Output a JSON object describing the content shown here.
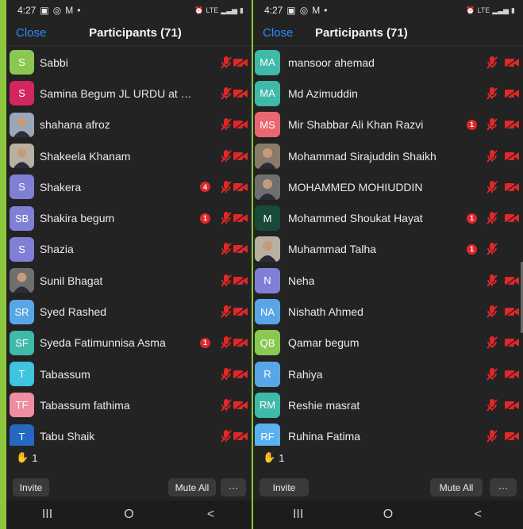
{
  "status": {
    "time": "4:27",
    "right": "LTE"
  },
  "header": {
    "close": "Close",
    "title": "Participants (71)"
  },
  "hand_count": "1",
  "buttons": {
    "invite": "Invite",
    "mute_all": "Mute All",
    "more": "···"
  },
  "nav": {
    "recents": "III",
    "home": "O",
    "back": "<"
  },
  "colors": {
    "pink": "#d3255f",
    "green": "#8ac851",
    "lavender": "#7f7fd6",
    "blue": "#58a6e6",
    "teal": "#3fb9a8",
    "cyan": "#3fc3de",
    "salmon": "#f08da1",
    "red": "#e86770",
    "dark": "#1a4a39",
    "tb": "#2468c1",
    "ruhina": "#5bb0f0"
  },
  "left_participants": [
    {
      "initials": "S",
      "name": "Sabbi",
      "color": "green",
      "photo": false
    },
    {
      "initials": "S",
      "name": "Samina Begum JL URDU at Jad...",
      "color": "pink",
      "photo": false
    },
    {
      "initials": "",
      "name": "shahana afroz",
      "color": "",
      "photo": true
    },
    {
      "initials": "",
      "name": "Shakeela Khanam",
      "color": "",
      "photo": true
    },
    {
      "initials": "S",
      "name": "Shakera",
      "color": "lavender",
      "photo": false,
      "badge": "4"
    },
    {
      "initials": "SB",
      "name": "Shakira begum",
      "color": "lavender",
      "photo": false,
      "badge": "1"
    },
    {
      "initials": "S",
      "name": "Shazia",
      "color": "lavender",
      "photo": false
    },
    {
      "initials": "",
      "name": "Sunil Bhagat",
      "color": "",
      "photo": true
    },
    {
      "initials": "SR",
      "name": "Syed Rashed",
      "color": "blue",
      "photo": false
    },
    {
      "initials": "SF",
      "name": "Syeda Fatimunnisa Asma",
      "color": "teal",
      "photo": false,
      "badge": "1"
    },
    {
      "initials": "T",
      "name": "Tabassum",
      "color": "cyan",
      "photo": false
    },
    {
      "initials": "TF",
      "name": "Tabassum fathima",
      "color": "salmon",
      "photo": false
    },
    {
      "initials": "T",
      "name": "Tabu Shaik",
      "color": "tb",
      "photo": false
    }
  ],
  "right_participants": [
    {
      "initials": "MA",
      "name": "mansoor ahemad",
      "color": "teal",
      "photo": false
    },
    {
      "initials": "MA",
      "name": "Md Azimuddin",
      "color": "teal",
      "photo": false
    },
    {
      "initials": "MS",
      "name": "Mir Shabbar Ali Khan Razvi",
      "color": "red",
      "photo": false,
      "badge": "1"
    },
    {
      "initials": "",
      "name": "Mohammad Sirajuddin Shaikh",
      "color": "",
      "photo": true
    },
    {
      "initials": "",
      "name": "MOHAMMED MOHIUDDIN",
      "color": "",
      "photo": true
    },
    {
      "initials": "M",
      "name": "Mohammed Shoukat Hayat",
      "color": "dark",
      "photo": false,
      "badge": "1"
    },
    {
      "initials": "",
      "name": "Muhammad Talha",
      "color": "",
      "photo": true,
      "badge": "1",
      "no_cam": true
    },
    {
      "initials": "N",
      "name": "Neha",
      "color": "lavender",
      "photo": false
    },
    {
      "initials": "NA",
      "name": "Nishath Ahmed",
      "color": "blue",
      "photo": false
    },
    {
      "initials": "QB",
      "name": "Qamar begum",
      "color": "green",
      "photo": false
    },
    {
      "initials": "R",
      "name": "Rahiya",
      "color": "blue",
      "photo": false
    },
    {
      "initials": "RM",
      "name": "Reshie masrat",
      "color": "teal",
      "photo": false
    },
    {
      "initials": "RF",
      "name": "Ruhina Fatima",
      "color": "ruhina",
      "photo": false
    }
  ]
}
